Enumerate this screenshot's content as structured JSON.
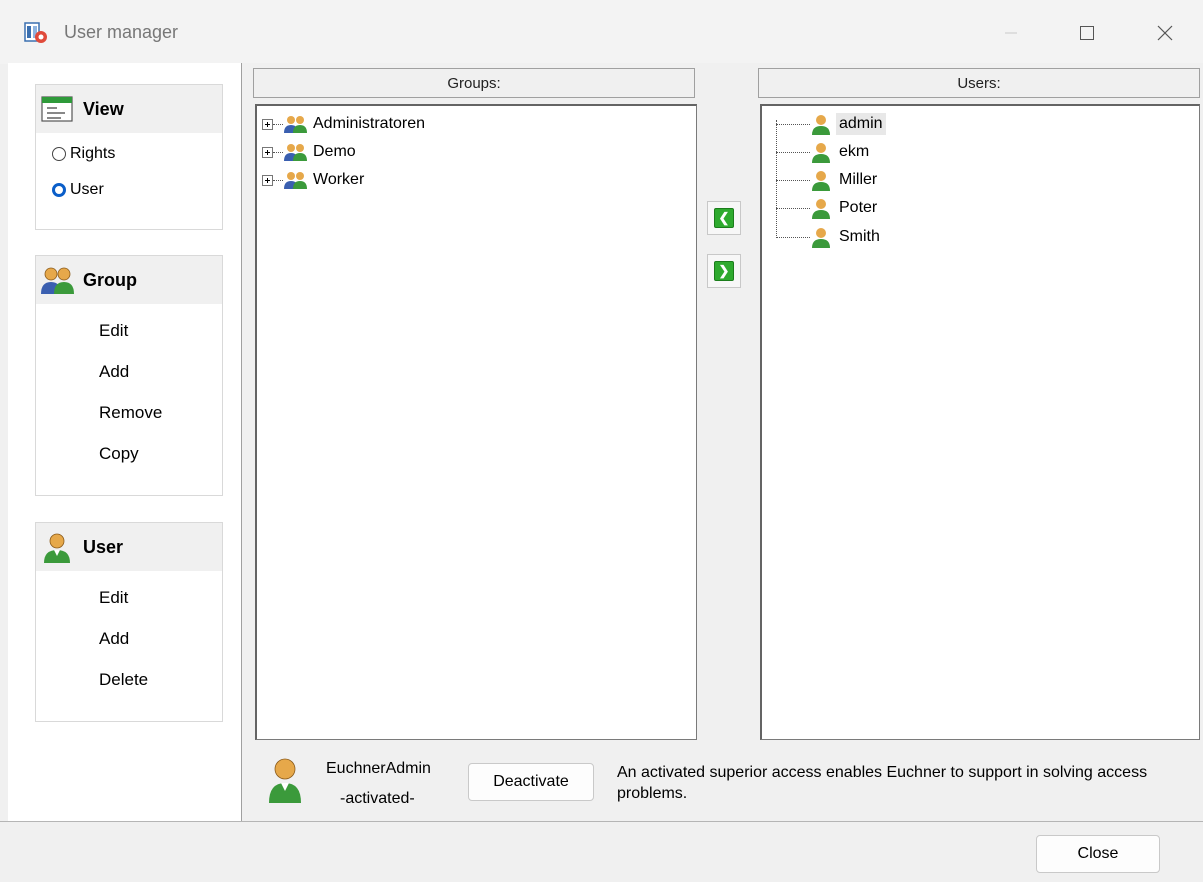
{
  "window": {
    "title": "User manager"
  },
  "view_section": {
    "title": "View",
    "options": [
      {
        "label": "Rights",
        "selected": false
      },
      {
        "label": "User",
        "selected": true
      }
    ]
  },
  "group_section": {
    "title": "Group",
    "actions": [
      "Edit",
      "Add",
      "Remove",
      "Copy"
    ]
  },
  "user_section": {
    "title": "User",
    "actions": [
      "Edit",
      "Add",
      "Delete"
    ]
  },
  "groups_panel": {
    "header": "Groups:",
    "items": [
      "Administratoren",
      "Demo",
      "Worker"
    ]
  },
  "users_panel": {
    "header": "Users:",
    "items": [
      "admin",
      "ekm",
      "Miller",
      "Poter",
      "Smith"
    ],
    "selected": "admin"
  },
  "superior_access": {
    "name": "EuchnerAdmin",
    "status": "-activated-",
    "button": "Deactivate",
    "description": "An activated superior access enables Euchner to support in solving access problems."
  },
  "footer": {
    "close_label": "Close"
  },
  "colors": {
    "accent": "#0a5ec9",
    "arrow_green": "#2eaa2e"
  }
}
